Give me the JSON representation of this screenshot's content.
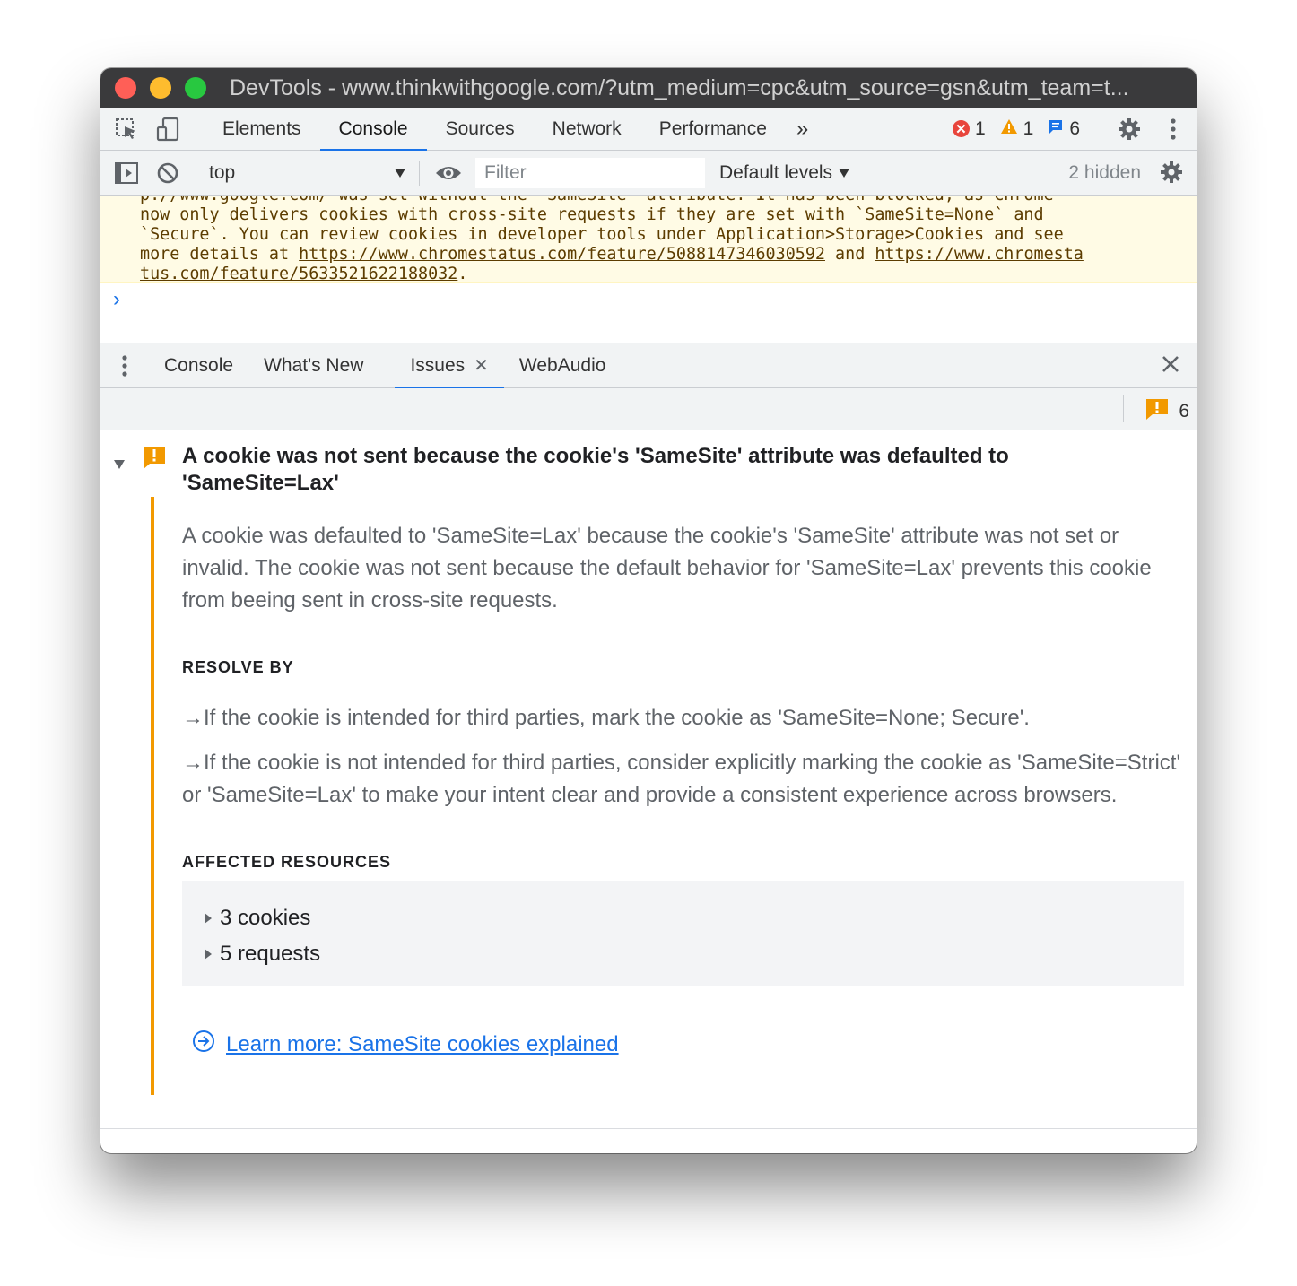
{
  "titlebar": {
    "title": "DevTools - www.thinkwithgoogle.com/?utm_medium=cpc&utm_source=gsn&utm_team=t..."
  },
  "main_toolbar": {
    "tabs": [
      "Elements",
      "Console",
      "Sources",
      "Network",
      "Performance"
    ],
    "active_tab": "Console",
    "more_tabs": "»",
    "error_count": "1",
    "warning_count": "1",
    "info_count": "6"
  },
  "console_toolbar": {
    "context": "top",
    "filter_placeholder": "Filter",
    "levels": "Default levels",
    "hidden": "2 hidden"
  },
  "console": {
    "line0": "p://www.google.com/ was set without the `SameSite` attribute. It has been blocked, as Chrome",
    "line1": "now only delivers cookies with cross-site requests if they are set with `SameSite=None` and",
    "line2": "`Secure`. You can review cookies in developer tools under Application>Storage>Cookies and see",
    "line3_prefix": "more details at ",
    "link1": "https://www.chromestatus.com/feature/5088147346030592",
    "line3_mid": " and ",
    "link2_part1": "https://www.chromesta",
    "link2_part2": "tus.com/feature/5633521622188032",
    "line4_suffix": "."
  },
  "drawer": {
    "tabs": [
      "Console",
      "What's New",
      "Issues",
      "WebAudio"
    ],
    "active_tab": "Issues",
    "issues_count": "6"
  },
  "issue": {
    "title": "A cookie was not sent because the cookie's 'SameSite' attribute was defaulted to 'SameSite=Lax'",
    "description": "A cookie was defaulted to 'SameSite=Lax' because the cookie's 'SameSite' attribute was not set or invalid. The cookie was not sent because the default behavior for 'SameSite=Lax' prevents this cookie from beeing sent in cross-site requests.",
    "resolve_heading": "RESOLVE BY",
    "resolve_1": "→If the cookie is intended for third parties, mark the cookie as 'SameSite=None; Secure'.",
    "resolve_2": "→If the cookie is not intended for third parties, consider explicitly marking the cookie as 'SameSite=Strict' or 'SameSite=Lax' to make your intent clear and provide a consistent experience across browsers.",
    "affected_heading": "AFFECTED RESOURCES",
    "affected_cookies": "3 cookies",
    "affected_requests": "5 requests",
    "learn_more": "Learn more: SameSite cookies explained"
  },
  "colors": {
    "accent": "#1a73e8",
    "warning": "#f29900",
    "warning_bg": "#fffbe5",
    "error": "#e8453c",
    "toolbar_bg": "#f1f3f4"
  }
}
